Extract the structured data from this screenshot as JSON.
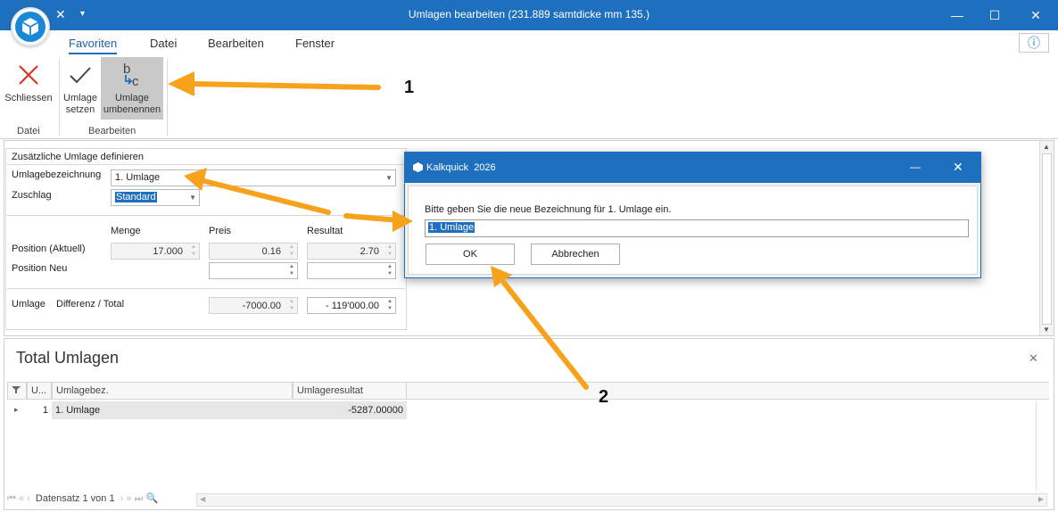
{
  "window": {
    "title": "Umlagen bearbeiten (231.889 samtdicke mm 135.)",
    "minimize": "—",
    "maximize": "☐",
    "close": "✕"
  },
  "quick_access": {
    "close_glyph": "✕",
    "dropdown_glyph": "▾"
  },
  "menu": {
    "items": [
      "Favoriten",
      "Datei",
      "Bearbeiten",
      "Fenster"
    ]
  },
  "info_glyph": "ⓘ",
  "ribbon": {
    "close_label": "Schliessen",
    "set_label_1": "Umlage",
    "set_label_2": "setzen",
    "rename_label_1": "Umlage",
    "rename_label_2": "umbenennen",
    "group_datei": "Datei",
    "group_bearbeiten": "Bearbeiten"
  },
  "form": {
    "section_title": "Zusätzliche Umlage definieren",
    "bezeichnung_label": "Umlagebezeichnung",
    "bezeichnung_value": "1. Umlage",
    "zuschlag_label": "Zuschlag",
    "zuschlag_value": "Standard",
    "col_menge": "Menge",
    "col_preis": "Preis",
    "col_resultat": "Resultat",
    "row_aktuell": "Position (Aktuell)",
    "row_neu": "Position Neu",
    "menge_aktuell": "17.000",
    "preis_aktuell": "0.16",
    "resultat_aktuell": "2.70",
    "umlage_label": "Umlage",
    "diff_label": "Differenz / Total",
    "diff_value": "-7000.00",
    "total_value": "- 119'000.00"
  },
  "dialog": {
    "title": "Kalkquick  2026",
    "message": "Bitte geben Sie die neue Bezeichnung für 1. Umlage ein.",
    "input_value": "1. Umlage",
    "ok_label": "OK",
    "cancel_label": "Abbrechen",
    "minimize": "—",
    "close": "✕"
  },
  "total": {
    "title": "Total Umlagen",
    "close_glyph": "✕",
    "columns": [
      "U...",
      "Umlagebez.",
      "Umlageresultat"
    ],
    "rows": [
      {
        "nr": "1",
        "bez": "1. Umlage",
        "resultat": "-5287.00000"
      }
    ],
    "row_indicator": "▸"
  },
  "navigator": {
    "first": "⏮",
    "prev_page": "«",
    "prev": "‹",
    "text": "Datensatz 1 von 1",
    "next": "›",
    "next_page": "»",
    "last": "⏭",
    "search_glyph": "🔍"
  },
  "annotations": {
    "one": "1",
    "two": "2",
    "arrow_color": "#f7a21b"
  }
}
